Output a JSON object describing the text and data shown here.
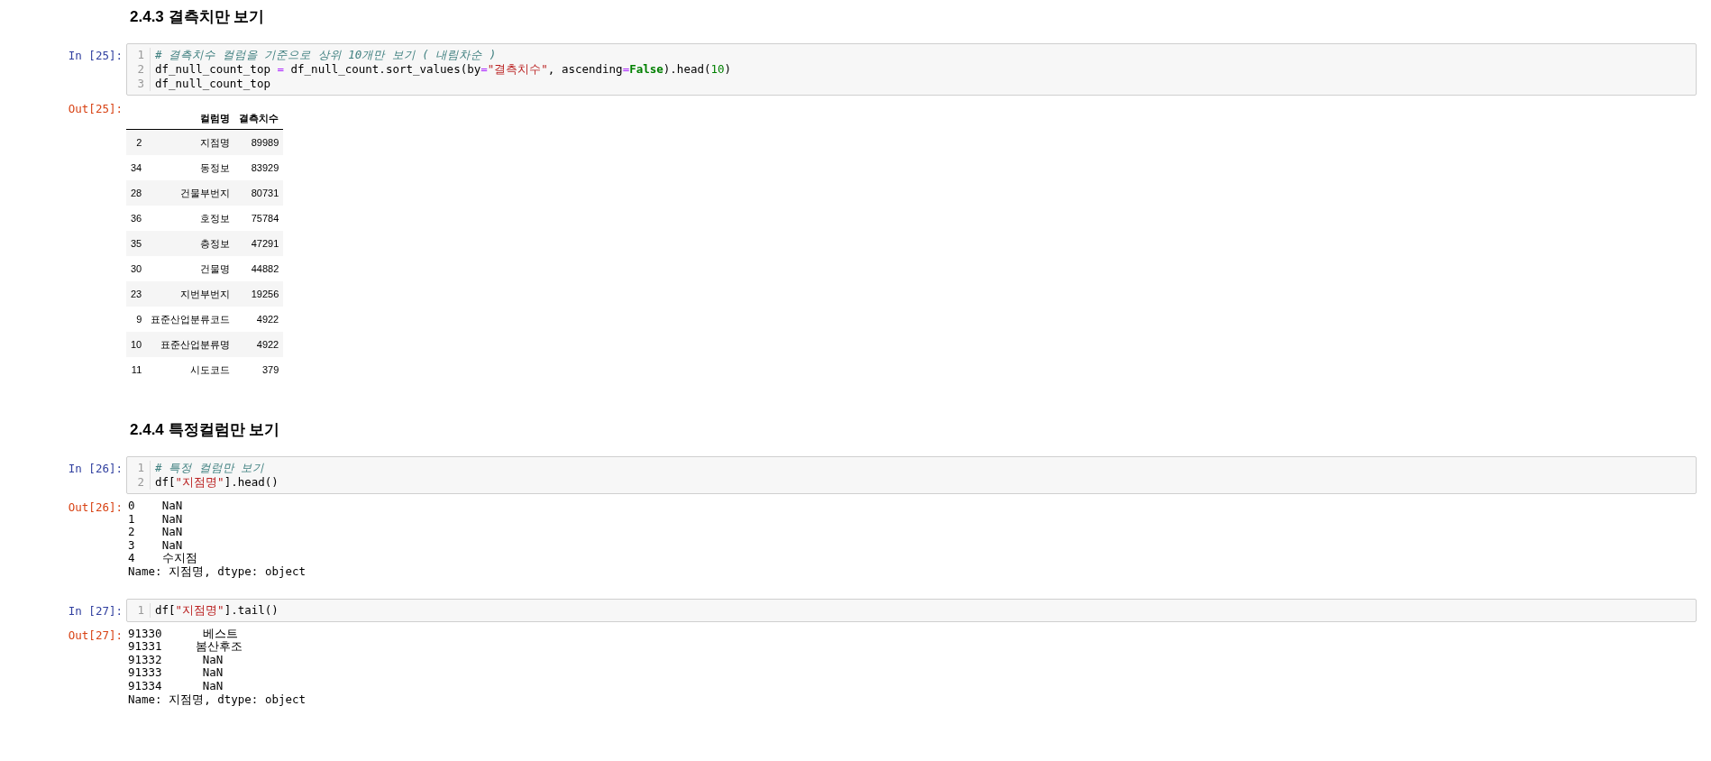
{
  "cells": [
    {
      "kind": "heading",
      "text": "2.4.3  결측치만 보기"
    },
    {
      "kind": "code",
      "prompt": "In [25]:",
      "lines": [
        {
          "number": "1",
          "tokens": [
            {
              "kind": "comment",
              "text": "# 결측치수 컬럼을 기준으로 상위 10개만 보기 ( 내림차순 )"
            }
          ]
        },
        {
          "number": "2",
          "tokens": [
            {
              "kind": "plain",
              "text": "df_null_count_top "
            },
            {
              "kind": "operator",
              "text": "="
            },
            {
              "kind": "plain",
              "text": " df_null_count.sort_values(by"
            },
            {
              "kind": "operator",
              "text": "="
            },
            {
              "kind": "string",
              "text": "\"결측치수\""
            },
            {
              "kind": "plain",
              "text": ", ascending"
            },
            {
              "kind": "operator",
              "text": "="
            },
            {
              "kind": "keyword",
              "text": "False"
            },
            {
              "kind": "plain",
              "text": ").head("
            },
            {
              "kind": "number",
              "text": "10"
            },
            {
              "kind": "plain",
              "text": ")"
            }
          ]
        },
        {
          "number": "3",
          "tokens": [
            {
              "kind": "plain",
              "text": "df_null_count_top"
            }
          ]
        }
      ],
      "output": {
        "kind": "table",
        "prompt": "Out[25]:",
        "columns": [
          "컬럼명",
          "결측치수"
        ],
        "rows": [
          {
            "index": "2",
            "cells": [
              "지점명",
              "89989"
            ]
          },
          {
            "index": "34",
            "cells": [
              "동정보",
              "83929"
            ]
          },
          {
            "index": "28",
            "cells": [
              "건물부번지",
              "80731"
            ]
          },
          {
            "index": "36",
            "cells": [
              "호정보",
              "75784"
            ]
          },
          {
            "index": "35",
            "cells": [
              "층정보",
              "47291"
            ]
          },
          {
            "index": "30",
            "cells": [
              "건물명",
              "44882"
            ]
          },
          {
            "index": "23",
            "cells": [
              "지번부번지",
              "19256"
            ]
          },
          {
            "index": "9",
            "cells": [
              "표준산업분류코드",
              "4922"
            ]
          },
          {
            "index": "10",
            "cells": [
              "표준산업분류명",
              "4922"
            ]
          },
          {
            "index": "11",
            "cells": [
              "시도코드",
              "379"
            ]
          }
        ]
      }
    },
    {
      "kind": "heading",
      "text": "2.4.4  특정컬럼만 보기"
    },
    {
      "kind": "code",
      "prompt": "In [26]:",
      "lines": [
        {
          "number": "1",
          "tokens": [
            {
              "kind": "comment",
              "text": "# 특정 컬럼만 보기"
            }
          ]
        },
        {
          "number": "2",
          "tokens": [
            {
              "kind": "plain",
              "text": "df["
            },
            {
              "kind": "string",
              "text": "\"지점명\""
            },
            {
              "kind": "plain",
              "text": "].head()"
            }
          ]
        }
      ],
      "output": {
        "kind": "text",
        "prompt": "Out[26]:",
        "lines": [
          "0    NaN",
          "1    NaN",
          "2    NaN",
          "3    NaN",
          "4    수지점",
          "Name: 지점명, dtype: object"
        ]
      }
    },
    {
      "kind": "code",
      "prompt": "In [27]:",
      "lines": [
        {
          "number": "1",
          "tokens": [
            {
              "kind": "plain",
              "text": "df["
            },
            {
              "kind": "string",
              "text": "\"지점명\""
            },
            {
              "kind": "plain",
              "text": "].tail()"
            }
          ]
        }
      ],
      "output": {
        "kind": "text",
        "prompt": "Out[27]:",
        "lines": [
          "91330      베스트",
          "91331     봄산후조",
          "91332      NaN",
          "91333      NaN",
          "91334      NaN",
          "Name: 지점명, dtype: object"
        ]
      }
    }
  ]
}
